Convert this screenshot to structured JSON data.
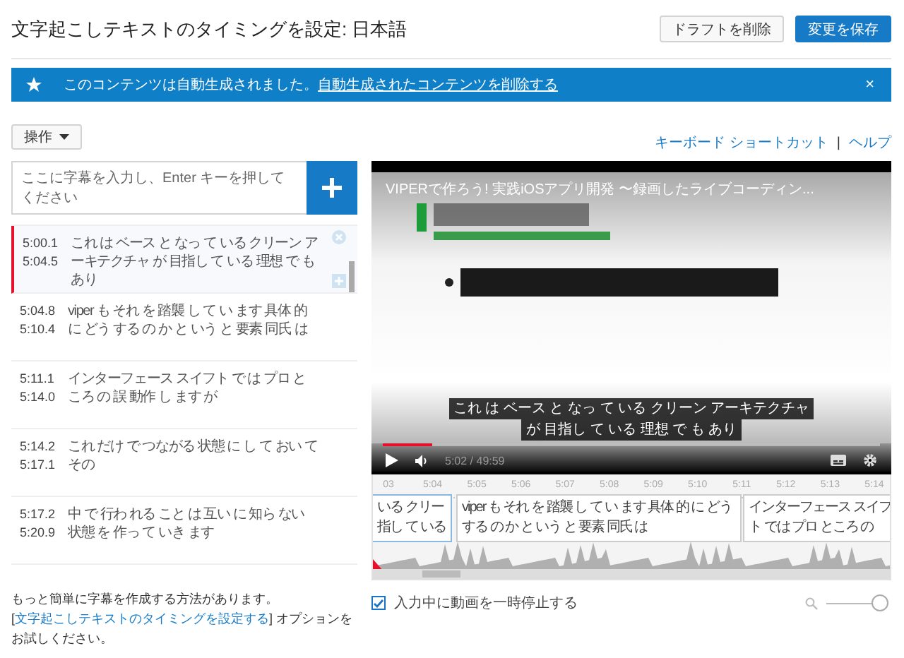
{
  "page": {
    "title": "文字起こしテキストのタイミングを設定: 日本語",
    "buttons": [
      {
        "label": "ドラフトを削除",
        "kind": "secondary"
      },
      {
        "label": "変更を保存",
        "kind": "primary"
      }
    ]
  },
  "banner": {
    "message": "このコンテンツは自動生成されました。",
    "link": "自動生成されたコンテンツを削除する",
    "close": "×"
  },
  "actions_menu": {
    "label": "操作"
  },
  "help_links": [
    {
      "label": "キーボード ショートカット"
    },
    {
      "label": "ヘルプ"
    }
  ],
  "help_separator": "|",
  "caption_input": {
    "placeholder": "ここに字幕を入力し、Enter キーを押してください"
  },
  "captions": [
    {
      "start": "5:00.1",
      "end": "5:04.5",
      "lines": [
        "これ は ベース と なっ て いる クリーン ア",
        "ーキテクチャ が 目指し て いる 理想 で も",
        "あり"
      ],
      "selected": true
    },
    {
      "start": "5:04.8",
      "end": "5:10.4",
      "lines": [
        "viper も それ を 踏襲 し て い ます 具体 的",
        "に どう する の か と いう と 要素 同氏 は"
      ],
      "selected": false
    },
    {
      "start": "5:11.1",
      "end": "5:14.0",
      "lines": [
        "インターフェース スイフト で は プロ と",
        "ころ の 誤 動作 し ます が"
      ],
      "selected": false
    },
    {
      "start": "5:14.2",
      "end": "5:17.1",
      "lines": [
        "これ だけ で つながる 状態 に し て おい て",
        "その"
      ],
      "selected": false
    },
    {
      "start": "5:17.2",
      "end": "5:20.9",
      "lines": [
        "中 で 行わ れる こと は 互い に 知ら ない",
        "状態 を 作っ て いき ます"
      ],
      "selected": false
    }
  ],
  "video": {
    "title": "VIPERで作ろう! 実践iOSアプリ開発 〜録画したライブコーディン...",
    "subtitle_lines": [
      "これ は ベース と なっ て いる クリーン アーキテクチャ",
      "が 目指し て いる 理想 で も あり"
    ],
    "time": "5:02 / 49:59",
    "progress": {
      "level": 0.1
    }
  },
  "timeline": {
    "ticks": [
      "03",
      "5:04",
      "5:05",
      "5:06",
      "5:07",
      "5:08",
      "5:09",
      "5:10",
      "5:11",
      "5:12",
      "5:13",
      "5:14"
    ],
    "cues": [
      {
        "lines": [
          "いる クリー",
          "指し て いる"
        ],
        "selected": true
      },
      {
        "lines": [
          "viper も それ を 踏襲 し て い ます 具体 的 に どう",
          "する の か と いう と 要素 同氏 は"
        ],
        "selected": false
      },
      {
        "lines": [
          "インターフェース スイフ",
          "ト では プロ ところ の"
        ],
        "selected": false
      }
    ]
  },
  "footer": {
    "hint_before": "もっと簡単に字幕を作成する方法があります。[",
    "hint_link": "文字起こしテキストのタイミングを設定する",
    "hint_after": "] オプションをお試しください。"
  },
  "pause_while_typing": {
    "label": "入力中に動画を一時停止する",
    "checked": true
  },
  "zoom": {
    "level": 1
  }
}
